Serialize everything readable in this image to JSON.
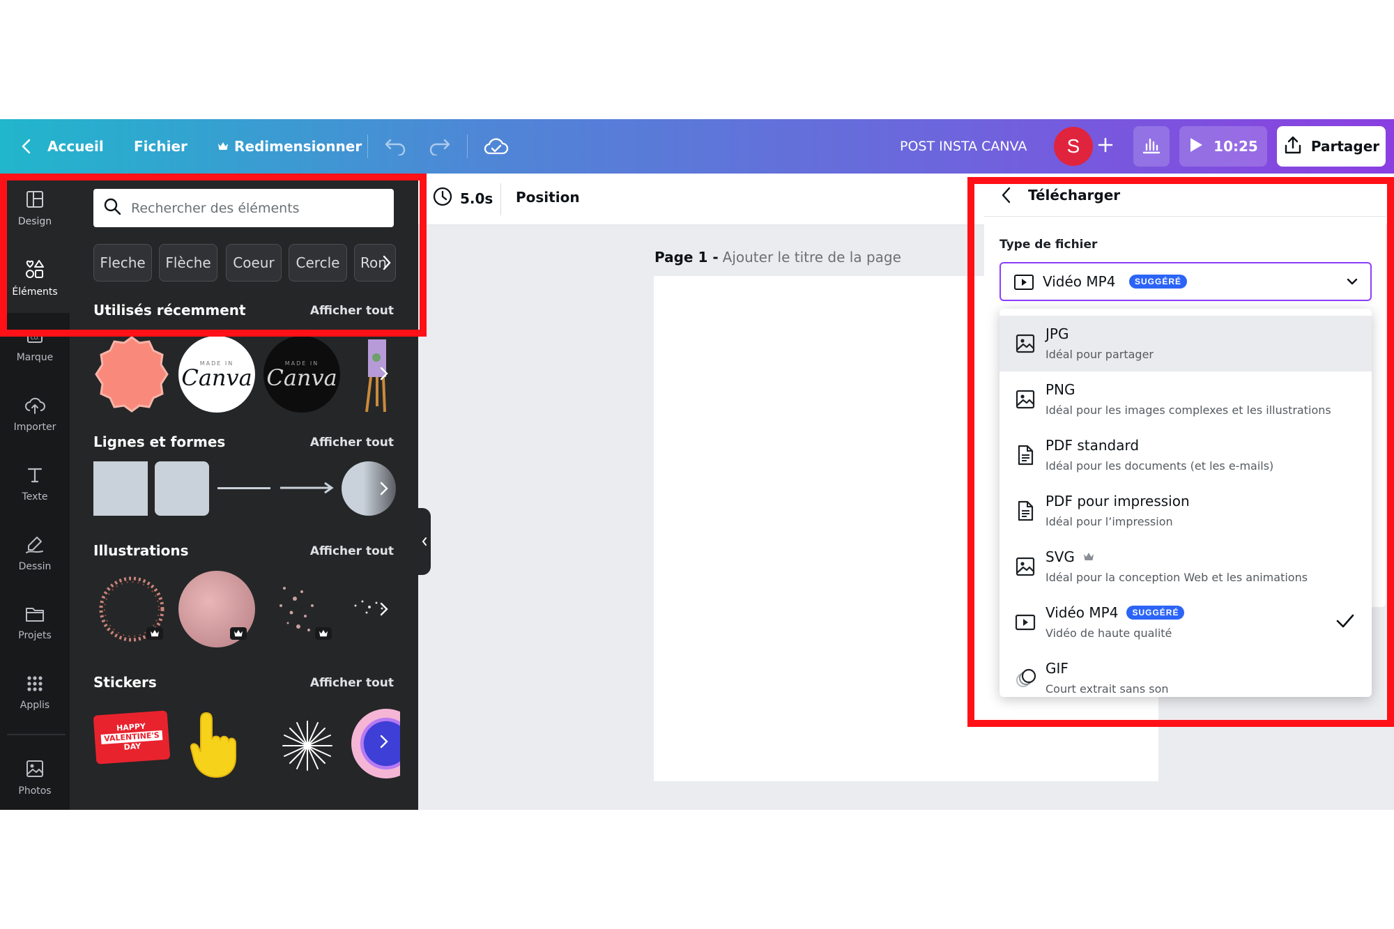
{
  "topbar": {
    "home_label": "Accueil",
    "file_label": "Fichier",
    "resize_label": "Redimensionner",
    "design_name": "POST INSTA CANVA",
    "avatar_initial": "S",
    "timer_label": "10:25",
    "share_label": "Partager"
  },
  "rail": {
    "items": [
      {
        "label": "Design",
        "icon": "layout-icon"
      },
      {
        "label": "Éléments",
        "icon": "shapes-icon"
      },
      {
        "label": "Marque",
        "icon": "brand-icon"
      },
      {
        "label": "Importer",
        "icon": "upload-cloud-icon"
      },
      {
        "label": "Texte",
        "icon": "text-icon"
      },
      {
        "label": "Dessin",
        "icon": "draw-icon"
      },
      {
        "label": "Projets",
        "icon": "folder-icon"
      },
      {
        "label": "Applis",
        "icon": "apps-icon"
      },
      {
        "label": "Photos",
        "icon": "image-icon"
      }
    ]
  },
  "panel": {
    "search_placeholder": "Rechercher des éléments",
    "chips": [
      "Fleche",
      "Flèche",
      "Coeur",
      "Cercle",
      "Ron"
    ],
    "sections": [
      {
        "title": "Utilisés récemment",
        "link": "Afficher tout"
      },
      {
        "title": "Lignes et formes",
        "link": "Afficher tout"
      },
      {
        "title": "Illustrations",
        "link": "Afficher tout"
      },
      {
        "title": "Stickers",
        "link": "Afficher tout"
      }
    ],
    "made_in_canva_small": "MADE IN",
    "made_in_canva_big": "Canva",
    "sticker_text": [
      "HAPPY",
      "VALENTINE'S",
      "DAY"
    ]
  },
  "editor": {
    "duration": "5.0s",
    "position_label": "Position",
    "page_label": "Page 1 -",
    "page_title_placeholder": "Ajouter le titre de la page"
  },
  "download": {
    "title": "Télécharger",
    "file_type_label": "Type de fichier",
    "selected_value": "Vidéo MP4",
    "suggested_badge": "SUGGÉRÉ",
    "options": [
      {
        "title": "JPG",
        "subtitle": "Idéal pour partager",
        "icon": "image-icon"
      },
      {
        "title": "PNG",
        "subtitle": "Idéal pour les images complexes et les illustrations",
        "icon": "image-icon"
      },
      {
        "title": "PDF standard",
        "subtitle": "Idéal pour les documents (et les e-mails)",
        "icon": "document-icon"
      },
      {
        "title": "PDF pour impression",
        "subtitle": "Idéal pour l’impression",
        "icon": "document-icon"
      },
      {
        "title": "SVG",
        "subtitle": "Idéal pour la conception Web et les animations",
        "icon": "image-icon"
      },
      {
        "title": "Vidéo MP4",
        "subtitle": "Vidéo de haute qualité",
        "icon": "video-icon"
      },
      {
        "title": "GIF",
        "subtitle": "Court extrait sans son",
        "icon": "gif-icon"
      }
    ]
  },
  "colors": {
    "highlight": "#ff1117",
    "accent": "#8b3dff",
    "badge": "#2b64f6",
    "avatar": "#e0243d"
  }
}
